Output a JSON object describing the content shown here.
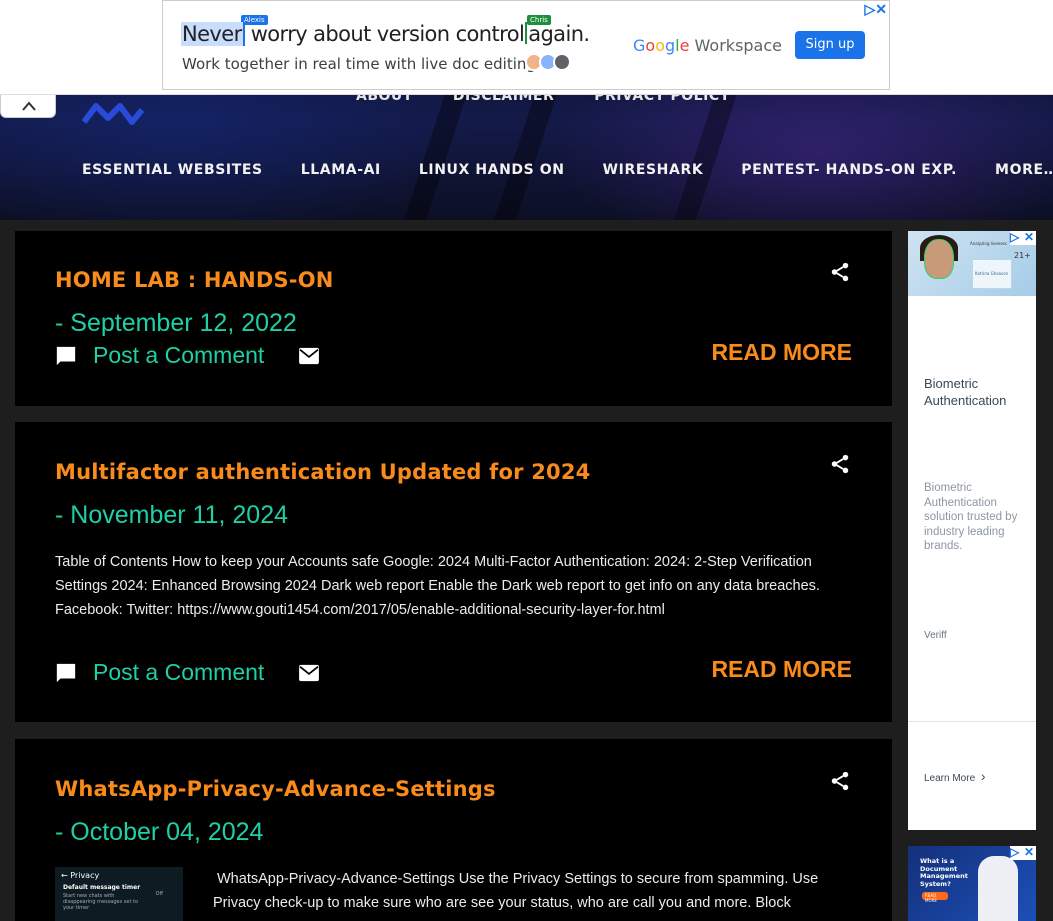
{
  "top_ad": {
    "headline_part1": "Never",
    "headline_part2": "worry about version control",
    "headline_part3": "again.",
    "tag_left": "Alexis",
    "tag_right": "Chris",
    "subline": "Work together in real time with live doc editing.",
    "brand_google": "Google",
    "brand_workspace": "Workspace",
    "cta": "Sign up",
    "close_symbol": "▷✕"
  },
  "nav": {
    "top_items": [
      "ABOUT",
      "DISCLAIMER",
      "PRIVACY POLICY"
    ],
    "main_items": [
      "ESSENTIAL WEBSITES",
      "LLAMA-AI",
      "LINUX HANDS ON",
      "WIRESHARK",
      "PENTEST- HANDS-ON EXP.",
      "MORE…"
    ]
  },
  "posts": [
    {
      "title": "HOME LAB : HANDS-ON",
      "date": "- September 12, 2022",
      "snippet": "",
      "comment_label": "Post a Comment",
      "read_more": "READ MORE"
    },
    {
      "title": "Multifactor authentication Updated for 2024",
      "date": "- November 11, 2024",
      "snippet": "Table of Contents How to keep your Accounts safe Google: 2024 Multi-Factor Authentication: 2024: 2-Step Verification Settings 2024: Enhanced Browsing  2024 Dark web report Enable the Dark web report to get info on any data breaches. Facebook: Twitter: https://www.gouti1454.com/2017/05/enable-additional-security-layer-for.html",
      "comment_label": "Post a Comment",
      "read_more": "READ MORE"
    },
    {
      "title": "WhatsApp-Privacy-Advance-Settings",
      "date": "- October 04, 2024",
      "snippet": "WhatsApp-Privacy-Advance-Settings Use the Privacy Settings to secure from spamming. Use Privacy check-up to make sure who are see your status, who are call you and more.   Block",
      "thumb": {
        "header": "← Privacy",
        "setting": "Default message timer",
        "setting_desc": "Start new chats with disappearing messages set to your timer",
        "setting_value": "Off"
      }
    }
  ],
  "side_ad": {
    "img_caption": "Analyzing liveness",
    "img_badge": "21+",
    "card_name": "Katrina Gheason",
    "headline": "Biometric Authentication",
    "description": "Biometric Authentication solution trusted by industry leading brands.",
    "advertiser": "Veriff",
    "learn_more": "Learn More",
    "chevron": "›"
  },
  "side_ad2": {
    "headline": "What is a Document Management System?",
    "button": "READ MORE"
  },
  "colors": {
    "title_orange": "#f98b1a",
    "date_teal": "#1fcfa5",
    "post_bg": "#000000",
    "page_bg": "#1e1e1e"
  }
}
